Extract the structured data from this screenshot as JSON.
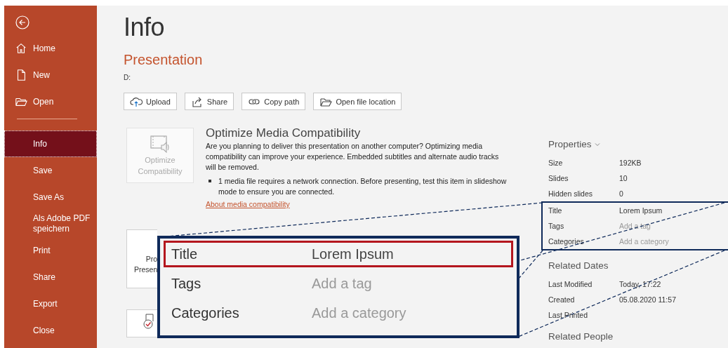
{
  "sidebar": {
    "groups": [
      [
        {
          "label": "Home",
          "selected": false
        },
        {
          "label": "New",
          "selected": false
        },
        {
          "label": "Open",
          "selected": false
        }
      ],
      [
        {
          "label": "Info",
          "selected": true
        },
        {
          "label": "Save",
          "selected": false
        },
        {
          "label": "Save As",
          "selected": false
        },
        {
          "label": "Als Adobe PDF speichern",
          "selected": false
        },
        {
          "label": "Print",
          "selected": false
        },
        {
          "label": "Share",
          "selected": false
        },
        {
          "label": "Export",
          "selected": false
        },
        {
          "label": "Close",
          "selected": false
        }
      ]
    ]
  },
  "page": {
    "title": "Info",
    "document": "Presentation",
    "path": "D:"
  },
  "toolbar": [
    "Upload",
    "Share",
    "Copy path",
    "Open file location"
  ],
  "optimize": {
    "button": [
      "Optimize",
      "Compatibility"
    ],
    "heading": "Optimize Media Compatibility",
    "text": "Are you planning to deliver this presentation on another computer? Optimizing media compatibility can improve your experience. Embedded subtitles and alternate audio tracks will be removed.",
    "bullet": "1 media file requires a network connection. Before presenting, test this item in slideshow mode to ensure you are connected.",
    "link": "About media compatibility"
  },
  "protect": {
    "button": [
      "Pro",
      "Presen"
    ]
  },
  "properties": {
    "heading": "Properties",
    "rows": [
      {
        "label": "Size",
        "value": "192KB"
      },
      {
        "label": "Slides",
        "value": "10"
      },
      {
        "label": "Hidden slides",
        "value": "0"
      }
    ],
    "highlighted_rows": [
      {
        "label": "Title",
        "value": "Lorem Ipsum"
      },
      {
        "label": "Tags",
        "placeholder": "Add a tag"
      },
      {
        "label": "Categories",
        "placeholder": "Add a category"
      }
    ]
  },
  "related_dates": {
    "heading": "Related Dates",
    "rows": [
      {
        "label": "Last Modified",
        "value": "Today, 17:22"
      },
      {
        "label": "Created",
        "value": "05.08.2020 11:57"
      },
      {
        "label": "Last Printed"
      }
    ]
  },
  "related_people": {
    "heading": "Related People"
  },
  "callout": {
    "rows": [
      {
        "label": "Title",
        "value": "Lorem Ipsum",
        "selected": true
      },
      {
        "label": "Tags",
        "placeholder": "Add a tag",
        "selected": false
      },
      {
        "label": "Categories",
        "placeholder": "Add a category",
        "selected": false
      }
    ]
  }
}
